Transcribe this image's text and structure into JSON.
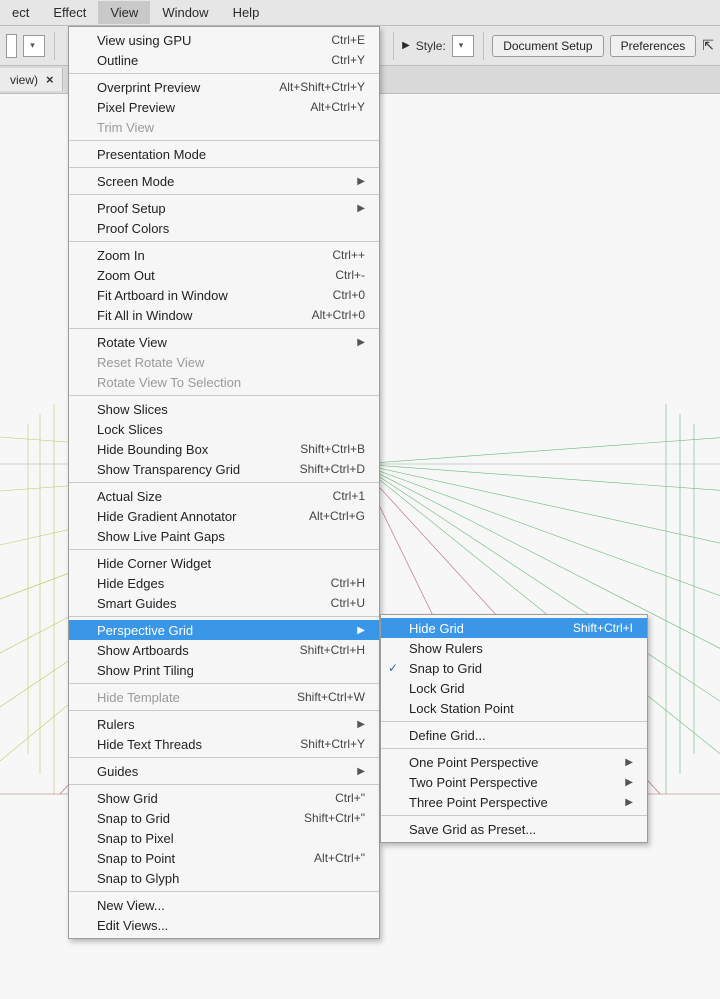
{
  "menubar": {
    "items": [
      "ect",
      "Effect",
      "View",
      "Window",
      "Help"
    ],
    "active_index": 2
  },
  "toolbar": {
    "style_label": "Style:",
    "doc_setup": "Document Setup",
    "preferences": "Preferences"
  },
  "tab": {
    "label": "view)",
    "close": "×"
  },
  "view_menu": [
    {
      "t": "item",
      "label": "View using GPU",
      "shortcut": "Ctrl+E"
    },
    {
      "t": "item",
      "label": "Outline",
      "shortcut": "Ctrl+Y"
    },
    {
      "t": "sep"
    },
    {
      "t": "item",
      "label": "Overprint Preview",
      "shortcut": "Alt+Shift+Ctrl+Y"
    },
    {
      "t": "item",
      "label": "Pixel Preview",
      "shortcut": "Alt+Ctrl+Y"
    },
    {
      "t": "item",
      "label": "Trim View",
      "disabled": true
    },
    {
      "t": "sep"
    },
    {
      "t": "item",
      "label": "Presentation Mode"
    },
    {
      "t": "sep"
    },
    {
      "t": "item",
      "label": "Screen Mode",
      "submenu": true
    },
    {
      "t": "sep"
    },
    {
      "t": "item",
      "label": "Proof Setup",
      "submenu": true
    },
    {
      "t": "item",
      "label": "Proof Colors"
    },
    {
      "t": "sep"
    },
    {
      "t": "item",
      "label": "Zoom In",
      "shortcut": "Ctrl++"
    },
    {
      "t": "item",
      "label": "Zoom Out",
      "shortcut": "Ctrl+-"
    },
    {
      "t": "item",
      "label": "Fit Artboard in Window",
      "shortcut": "Ctrl+0"
    },
    {
      "t": "item",
      "label": "Fit All in Window",
      "shortcut": "Alt+Ctrl+0"
    },
    {
      "t": "sep"
    },
    {
      "t": "item",
      "label": "Rotate View",
      "submenu": true
    },
    {
      "t": "item",
      "label": "Reset Rotate View",
      "disabled": true
    },
    {
      "t": "item",
      "label": "Rotate View To Selection",
      "disabled": true
    },
    {
      "t": "sep"
    },
    {
      "t": "item",
      "label": "Show Slices"
    },
    {
      "t": "item",
      "label": "Lock Slices"
    },
    {
      "t": "item",
      "label": "Hide Bounding Box",
      "shortcut": "Shift+Ctrl+B"
    },
    {
      "t": "item",
      "label": "Show Transparency Grid",
      "shortcut": "Shift+Ctrl+D"
    },
    {
      "t": "sep"
    },
    {
      "t": "item",
      "label": "Actual Size",
      "shortcut": "Ctrl+1"
    },
    {
      "t": "item",
      "label": "Hide Gradient Annotator",
      "shortcut": "Alt+Ctrl+G"
    },
    {
      "t": "item",
      "label": "Show Live Paint Gaps"
    },
    {
      "t": "sep"
    },
    {
      "t": "item",
      "label": "Hide Corner Widget"
    },
    {
      "t": "item",
      "label": "Hide Edges",
      "shortcut": "Ctrl+H"
    },
    {
      "t": "item",
      "label": "Smart Guides",
      "shortcut": "Ctrl+U"
    },
    {
      "t": "sep"
    },
    {
      "t": "item",
      "label": "Perspective Grid",
      "submenu": true,
      "highlight": true
    },
    {
      "t": "item",
      "label": "Show Artboards",
      "shortcut": "Shift+Ctrl+H"
    },
    {
      "t": "item",
      "label": "Show Print Tiling"
    },
    {
      "t": "sep"
    },
    {
      "t": "item",
      "label": "Hide Template",
      "shortcut": "Shift+Ctrl+W",
      "disabled": true
    },
    {
      "t": "sep"
    },
    {
      "t": "item",
      "label": "Rulers",
      "submenu": true
    },
    {
      "t": "item",
      "label": "Hide Text Threads",
      "shortcut": "Shift+Ctrl+Y"
    },
    {
      "t": "sep"
    },
    {
      "t": "item",
      "label": "Guides",
      "submenu": true
    },
    {
      "t": "sep"
    },
    {
      "t": "item",
      "label": "Show Grid",
      "shortcut": "Ctrl+\""
    },
    {
      "t": "item",
      "label": "Snap to Grid",
      "shortcut": "Shift+Ctrl+\""
    },
    {
      "t": "item",
      "label": "Snap to Pixel"
    },
    {
      "t": "item",
      "label": "Snap to Point",
      "shortcut": "Alt+Ctrl+\""
    },
    {
      "t": "item",
      "label": "Snap to Glyph"
    },
    {
      "t": "sep"
    },
    {
      "t": "item",
      "label": "New View..."
    },
    {
      "t": "item",
      "label": "Edit Views..."
    }
  ],
  "pg_submenu": [
    {
      "t": "item",
      "label": "Hide Grid",
      "shortcut": "Shift+Ctrl+I",
      "highlight": true
    },
    {
      "t": "item",
      "label": "Show Rulers"
    },
    {
      "t": "item",
      "label": "Snap to Grid",
      "checked": true
    },
    {
      "t": "item",
      "label": "Lock Grid"
    },
    {
      "t": "item",
      "label": "Lock Station Point"
    },
    {
      "t": "sep"
    },
    {
      "t": "item",
      "label": "Define Grid..."
    },
    {
      "t": "sep"
    },
    {
      "t": "item",
      "label": "One Point Perspective",
      "submenu": true
    },
    {
      "t": "item",
      "label": "Two Point Perspective",
      "submenu": true
    },
    {
      "t": "item",
      "label": "Three Point Perspective",
      "submenu": true
    },
    {
      "t": "sep"
    },
    {
      "t": "item",
      "label": "Save Grid as Preset..."
    }
  ]
}
